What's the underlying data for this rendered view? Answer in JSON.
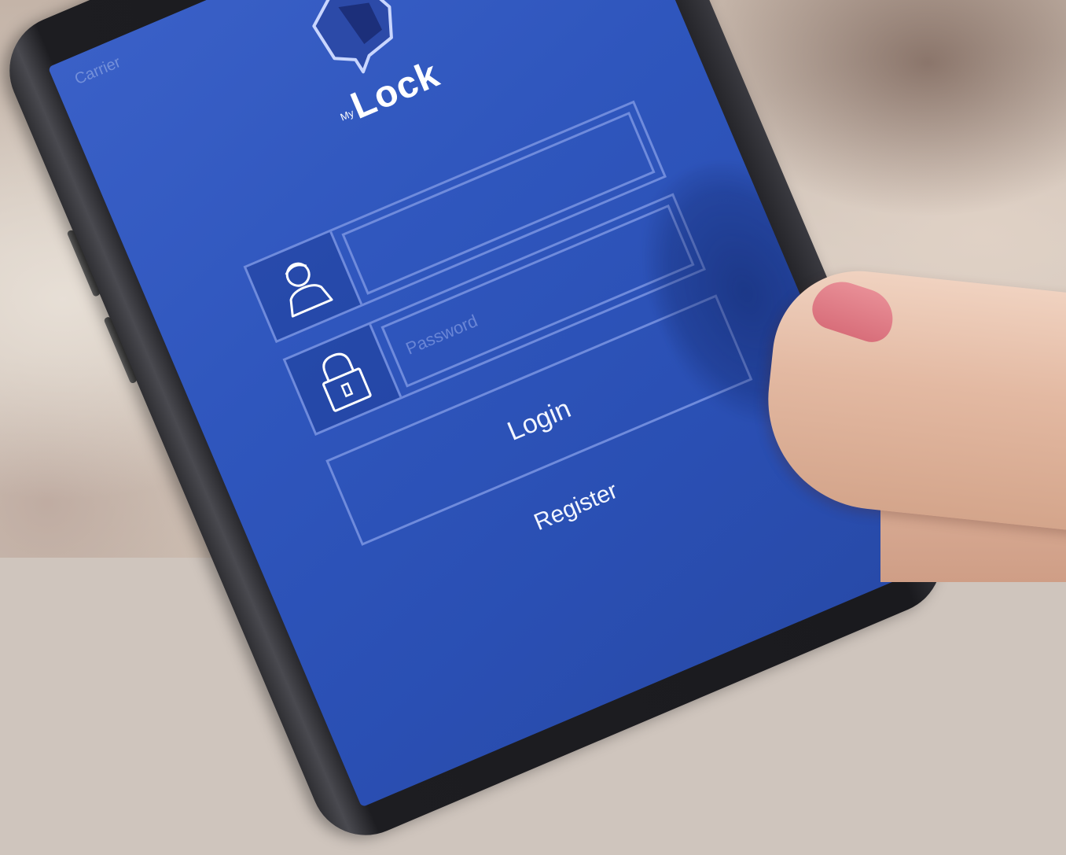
{
  "status": {
    "carrier": "Carrier"
  },
  "app": {
    "title_prefix": "My",
    "title": "Lock"
  },
  "form": {
    "username_placeholder": "",
    "password_placeholder": "Password",
    "login_label": "Login",
    "register_label": "Register"
  },
  "icons": {
    "logo": "speech-bubble-head-logo",
    "username": "user-icon",
    "password": "padlock-icon"
  },
  "colors": {
    "screen_blue": "#2f56bd",
    "outline": "#6f8bdc",
    "text": "#ffffff",
    "nail": "#d86e7a"
  }
}
